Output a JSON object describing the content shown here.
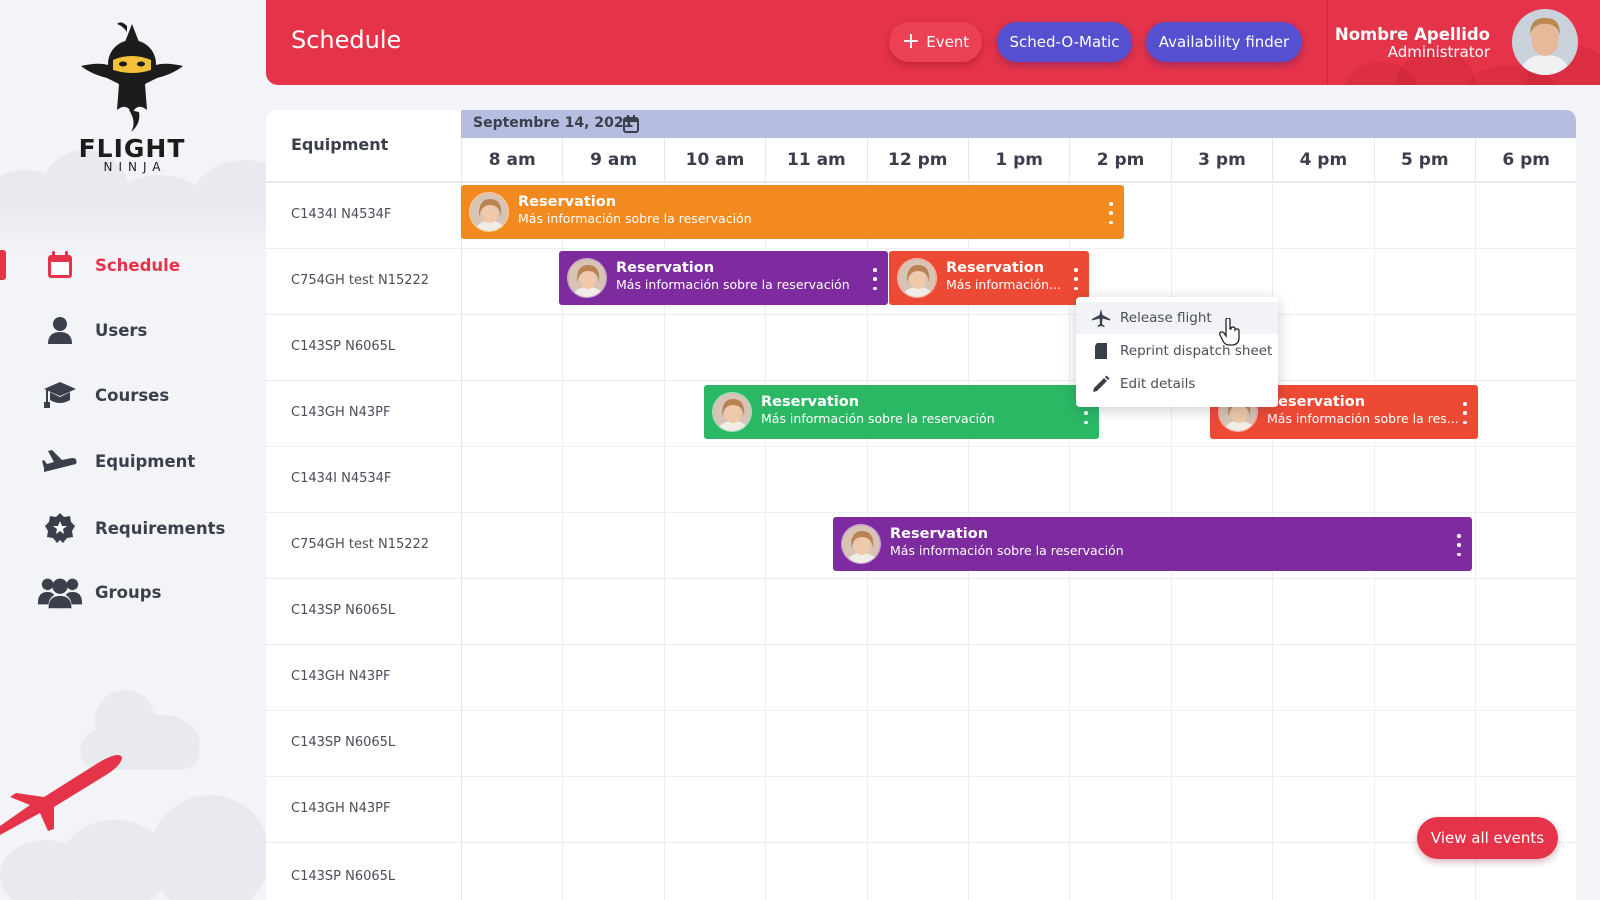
{
  "brand": {
    "name": "FLIGHT",
    "sub": "NINJA"
  },
  "nav": [
    {
      "label": "Schedule",
      "icon": "calendar-icon",
      "active": true
    },
    {
      "label": "Users",
      "icon": "user-icon"
    },
    {
      "label": "Courses",
      "icon": "graduation-cap-icon"
    },
    {
      "label": "Equipment",
      "icon": "plane-icon"
    },
    {
      "label": "Requirements",
      "icon": "certificate-icon"
    },
    {
      "label": "Groups",
      "icon": "users-group-icon"
    }
  ],
  "header": {
    "title": "Schedule",
    "event_button": "Event",
    "schedomatic_button": "Sched-O-Matic",
    "availability_button": "Availability finder",
    "user_name": "Nombre Apellido",
    "user_role": "Administrator"
  },
  "schedule": {
    "equipment_header": "Equipment",
    "date": "Septembre 14, 2021",
    "hours": [
      "8 am",
      "9 am",
      "10 am",
      "11 am",
      "12 pm",
      "1 pm",
      "2 pm",
      "3 pm",
      "4 pm",
      "5 pm",
      "6 pm"
    ],
    "rows": [
      "C1434I N4534F",
      "C754GH test N15222",
      "C143SP N6065L",
      "C143GH N43PF",
      "C1434I N4534F",
      "C754GH test N15222",
      "C143SP N6065L",
      "C143GH N43PF",
      "C143SP N6065L",
      "C143GH N43PF",
      "C143SP N6065L"
    ],
    "events": [
      {
        "title": "Reservation",
        "subtitle": "Más información sobre la reservación",
        "color": "orange"
      },
      {
        "title": "Reservation",
        "subtitle": "Más información sobre la reservación",
        "color": "purple"
      },
      {
        "title": "Reservation",
        "subtitle": "Más información...",
        "color": "red"
      },
      {
        "title": "Reservation",
        "subtitle": "Más información sobre la reservación",
        "color": "green"
      },
      {
        "title": "Reservation",
        "subtitle": "Más información sobre la res...",
        "color": "red"
      },
      {
        "title": "Reservation",
        "subtitle": "Más información sobre la reservación",
        "color": "purple"
      }
    ]
  },
  "context_menu": {
    "items": [
      {
        "label": "Release flight",
        "icon": "plane-icon"
      },
      {
        "label": "Reprint dispatch sheet",
        "icon": "document-icon"
      },
      {
        "label": "Edit details",
        "icon": "pencil-icon"
      }
    ]
  },
  "view_all_button": "View all events",
  "colors": {
    "brand_red": "#e5344a",
    "indigo": "#5450cf",
    "orange": "#f38a1f",
    "purple": "#7d2b9e",
    "red": "#ec4a34",
    "green": "#2bb865",
    "date_bar": "#b7bde0"
  }
}
